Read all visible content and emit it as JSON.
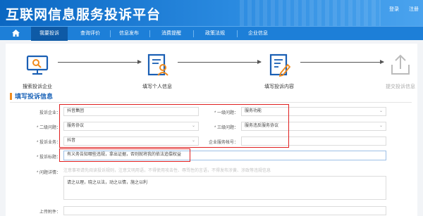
{
  "header": {
    "title": "互联网信息服务投诉平台",
    "links": [
      "登录",
      "注册"
    ]
  },
  "nav": {
    "items": [
      "我要投诉",
      "查询评价",
      "信息发布",
      "消费提醒",
      "政策法规",
      "企业信息"
    ],
    "active_index": 0
  },
  "steps": [
    {
      "label": "搜索投诉企业",
      "icon": "monitor-icon"
    },
    {
      "label": "填写个人信息",
      "icon": "person-form-icon"
    },
    {
      "label": "填写投诉内容",
      "icon": "edit-form-icon"
    },
    {
      "label": "提交投诉信息",
      "icon": "upload-icon"
    }
  ],
  "section_title": "填写投诉信息",
  "form": {
    "company_label": "投诉企业：",
    "company_value": "抖音集团",
    "level1_label": "* 一级问题：",
    "level1_value": "服务功能",
    "level2_label": "* 二级问题：",
    "level2_value": "服务协议",
    "level3_label": "* 三级问题：",
    "level3_value": "服务违反服务协议",
    "business_label": "* 投诉业务：",
    "business_value": "抖音",
    "account_label": "企业服务帐号：",
    "account_value": "",
    "subject_label": "* 投诉标题：",
    "subject_value": "有义务告知哪些违规，拿出证据，否则就将我的依法追偿权益",
    "detail_label": "* 问题详情：",
    "detail_hint": "注意事项请先阅读投诉规则，注意文明用语，不得使用攻击性、辱骂性的言语，不得发布涉黄、涉政等违规信息",
    "detail_value": "请之以理，晓之以法，动之以情，施之以利",
    "attach_label": "上传附件："
  },
  "colors": {
    "banner": "#0b67c2",
    "nav": "#1d7fd8",
    "nav_active": "#0e5aa6",
    "section_title": "#1a63b8",
    "highlight_box": "#e02020"
  }
}
